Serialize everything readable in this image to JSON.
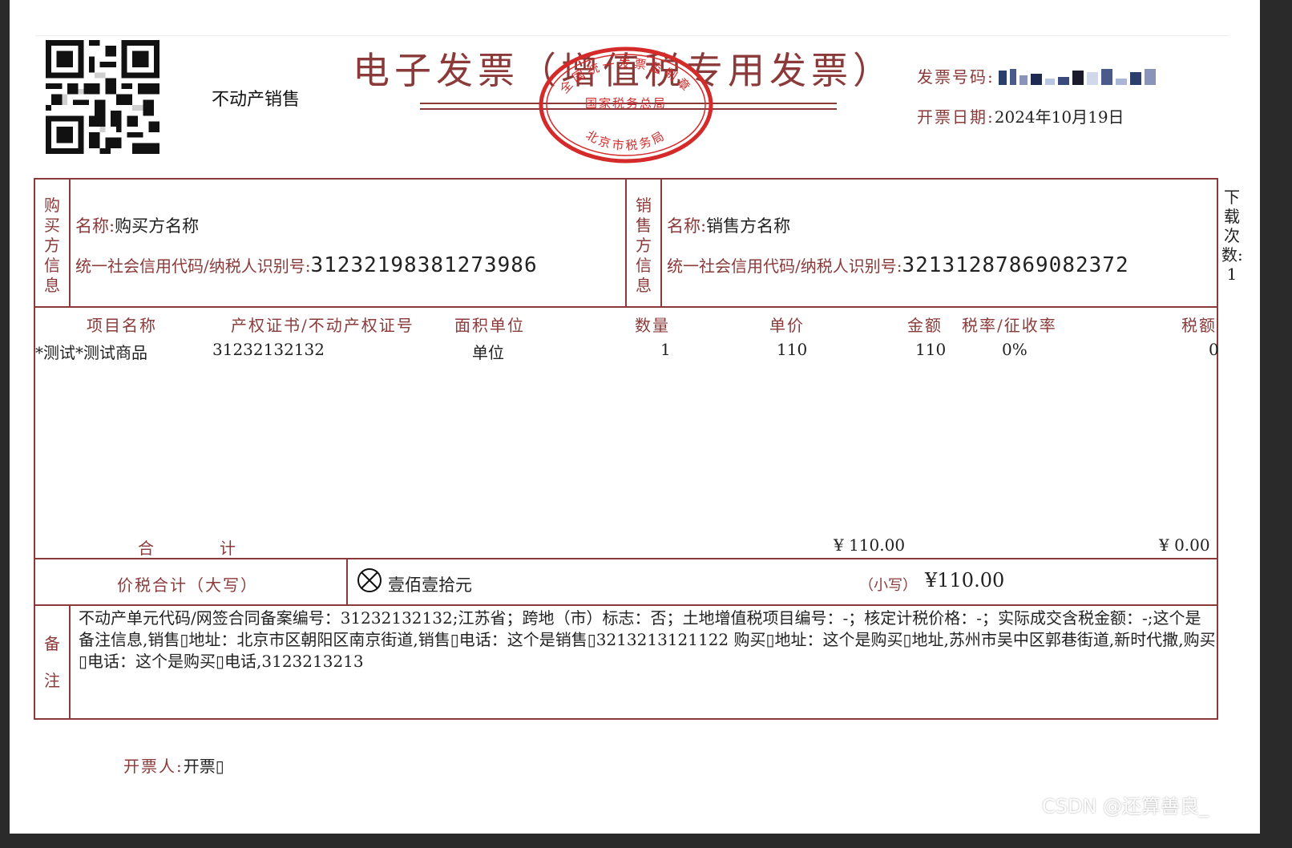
{
  "header": {
    "category": "不动产销售",
    "title": "电子发票（增值税专用发票）",
    "invoice_no_label": "发票号码:",
    "date_label": "开票日期:",
    "date_value": "2024年10月19日",
    "download_count": "下载次数: 1"
  },
  "seal": {
    "top_text": "全国统一发票监制章",
    "middle_text": "国家税务总局",
    "bottom_text": "北京市税务局"
  },
  "buyer": {
    "section_label": "购买方信息",
    "name_label": "名称:",
    "name_value": "购买方名称",
    "tax_label": "统一社会信用代码/纳税人识别号:",
    "tax_value": "31232198381273986"
  },
  "seller": {
    "section_label": "销售方信息",
    "name_label": "名称:",
    "name_value": "销售方名称",
    "tax_label": "统一社会信用代码/纳税人识别号:",
    "tax_value": "32131287869082372"
  },
  "items": {
    "headers": [
      "项目名称",
      "产权证书/不动产权证号",
      "面积单位",
      "数量",
      "单价",
      "金额",
      "税率/征收率",
      "税额"
    ],
    "rows": [
      [
        "*测试*测试商品",
        "31232132132",
        "单位",
        "1",
        "110",
        "110",
        "0%",
        "0"
      ]
    ]
  },
  "totals": {
    "label_1": "合",
    "label_2": "计",
    "amount": "¥ 110.00",
    "tax": "¥ 0.00"
  },
  "grand_total": {
    "upper_label": "价税合计（大写）",
    "upper_value": "壹佰壹拾元",
    "lower_label": "（小写）",
    "lower_value": "¥110.00"
  },
  "remarks": {
    "label": "备注",
    "text": "不动产单元代码/网签合同备案编号：31232132132;江苏省；跨地（市）标志：否；土地增值税项目编号：-；核定计税价格：-；实际成交含税金额：-;这个是备注信息,销售▯地址：北京市区朝阳区南京街道,销售▯电话：这个是销售▯3213213121122 购买▯地址：这个是购买▯地址,苏州市吴中区郭巷街道,新时代撒,购买▯电话：这个是购买▯电话,3123213213"
  },
  "issuer": {
    "label": "开票人:",
    "value": "开票▯"
  },
  "watermark": "CSDN @还算善良_",
  "colors": {
    "accent": "#8b3a3a",
    "seal": "#d42a2a"
  }
}
